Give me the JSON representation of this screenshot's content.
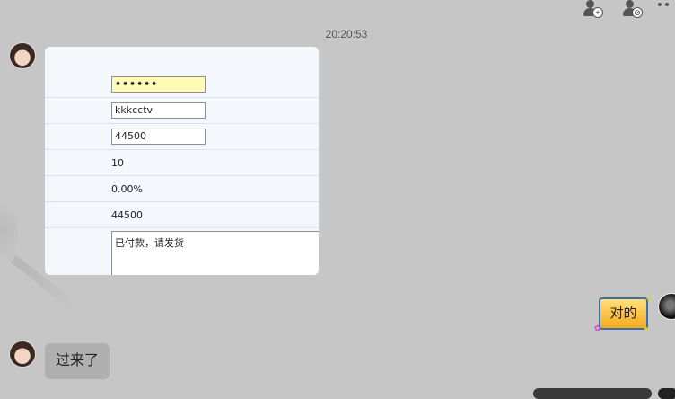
{
  "toolbar": {
    "add_contact_icon": "add-contact-icon",
    "block_contact_icon": "block-contact-icon",
    "more_icon": "more-icon"
  },
  "chat": {
    "timestamp": "20:20:53",
    "form_card": {
      "password_value": "••••••",
      "account_value": "kkkcctv",
      "amount_value": "44500",
      "quantity": "10",
      "rate": "0.00%",
      "total": "44500",
      "note": "已付款，请发货"
    },
    "reply_right": "对的",
    "reply_left": "过来了"
  }
}
